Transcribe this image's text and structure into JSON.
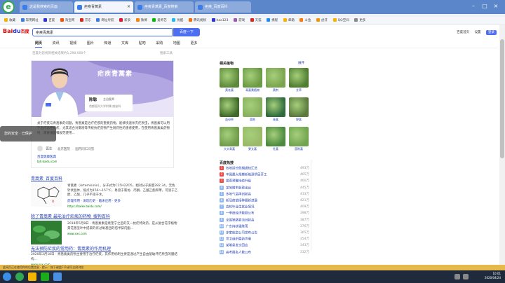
{
  "browser": {
    "tabs": [
      {
        "label": "这是我搜索的页面"
      },
      {
        "label": "疟疾青蒿素"
      },
      {
        "label": "疟疾青蒿素_百度搜索"
      },
      {
        "label": "疟疾_百度百科"
      }
    ],
    "bookmarks": [
      "收藏",
      "常用网址",
      "百度",
      "淘宝网",
      "京东",
      "网址导航",
      "新浪",
      "微博",
      "爱奇艺",
      "优酷",
      "腾讯视频",
      "hao123",
      "游戏",
      "天猫",
      "携程",
      "邮箱",
      "斗鱼",
      "虎牙",
      "QQ空间",
      "更多"
    ],
    "colors": {
      "accent": "#4e6ef2",
      "titlebar": "#5b86c9",
      "link": "#2440b3",
      "url": "#008000"
    }
  },
  "search": {
    "logo_text": "Bai",
    "logo_paw": "du",
    "logo_cn": "百度",
    "query": "疟疾青蒿素",
    "button_label": "百度一下",
    "top_links": [
      "百度首页",
      "设置",
      "登录"
    ]
  },
  "nav": {
    "tabs": [
      "网页",
      "资讯",
      "视频",
      "图片",
      "知道",
      "文库",
      "贴吧",
      "采购",
      "地图",
      "更多"
    ],
    "result_count": "百度为您找到相关结果约1,290,000个",
    "tools": "搜索工具"
  },
  "card": {
    "banner_title": "疟疾青蒿素",
    "doctor_name": "陈聪",
    "doctor_title": "主治医师",
    "doctor_dept": "首都医科大学附属 感染科",
    "text": "关于疟疾与青蒿素的问题，青蒿素是治疗疟疾的重要药物，能够快速杀灭疟原虫，青蒿素可以用于治疗恶性疟疾，尤其适合对氯喹等传统抗疟药物产生耐药性的患者使用，在使用青蒿素类药物时，需要遵医嘱规范使用...",
    "meta_author": "医生",
    "meta_tag": "北京医院",
    "meta_extra": "国内同仁问答",
    "source": "百度健康医典",
    "source_url": "bjh.baidu.com"
  },
  "tooltip": "您的安全 · 已保护",
  "results": [
    {
      "title": "青蒿素_百度百科",
      "body": "青蒿素（Artemisinin），分子式为C15H22O5，相对分子质量282.34，无色针状晶体，熔点为156～157℃，易溶于氯仿、丙酮、乙酸乙酯和苯，可溶于乙醇、乙醚，几乎不溶于水。",
      "links": "药理作用 · 发现历史 · 临床应用 · 更多",
      "url": "https://baike.baidu.com/"
    },
    {
      "title": "除了青蒿素 最能治疗疟疾的药物_搜狗百科",
      "body": "2018年5月8日 · 青蒿素素是继奎宁之后的又一抗疟特效药，是从复合花序植物黄花蒿茎叶中提取的有过氧基团的倍半萜内酯...",
      "url": "www.xxx.com"
    },
    {
      "title": "无法预防疟疾的常用药：青蒿素的作用机理",
      "body": "2020年3月18日 · 青蒿素类药物主要用于治疗疟疾，其作用机制主要是通过产生自由基破坏疟原虫的膜结构...",
      "url": "www.xxx.com"
    }
  ],
  "sidebar": {
    "title": "相关植物",
    "more": "展开",
    "plants": [
      {
        "label": "黄花蒿",
        "color": "#5c8a3a"
      },
      {
        "label": "青蒿素植物",
        "color": "#6b9a45"
      },
      {
        "label": "黄荆",
        "color": "#7ba44f"
      },
      {
        "label": "艾草",
        "color": "#4f7d32"
      },
      {
        "label": "益母草",
        "color": "#3f6b2a"
      },
      {
        "label": "茵陈",
        "color": "#86b05d"
      },
      {
        "label": "青蒿",
        "color": "#2f6b3c"
      },
      {
        "label": "野蒿",
        "color": "#5a7a3e"
      },
      {
        "label": "大头青蒿",
        "color": "#6f9c4b"
      },
      {
        "label": "野艾蒿",
        "color": "#9ab968"
      },
      {
        "label": "牡蒿",
        "color": "#4c8a3f"
      },
      {
        "label": "茵陈蒿",
        "color": "#72a450"
      }
    ],
    "hot_title": "百度热搜",
    "hot_items": [
      {
        "num": "1",
        "text": "各地延长假期通知汇总",
        "value": "493万"
      },
      {
        "num": "2",
        "text": "中国最大规模新能源项目开工",
        "value": "465万"
      },
      {
        "num": "3",
        "text": "暴雨预警持续升级",
        "value": "460万"
      },
      {
        "num": "4",
        "text": "某地楼市新政出台",
        "value": "445万"
      },
      {
        "num": "5",
        "text": "多地气温再创新高",
        "value": "433万"
      },
      {
        "num": "6",
        "text": "新冠疫苗接种最新进展",
        "value": "421万"
      },
      {
        "num": "7",
        "text": "高校毕业生就业情况",
        "value": "409万"
      },
      {
        "num": "8",
        "text": "一季度经济数据公布",
        "value": "398万"
      },
      {
        "num": "9",
        "text": "全国铁路客流创新高",
        "value": "387万"
      },
      {
        "num": "10",
        "text": "广东持续强降雨",
        "value": "376万"
      },
      {
        "num": "11",
        "text": "多家航空公司发布公告",
        "value": "365万"
      },
      {
        "num": "12",
        "text": "世卫组织最新声明",
        "value": "354万"
      },
      {
        "num": "13",
        "text": "某明星发文回应",
        "value": "343万"
      },
      {
        "num": "14",
        "text": "高考报名人数公布",
        "value": "332万"
      }
    ]
  },
  "statusbar": "此网页正在使用你的位置信息 · 提示：按下键盘F11键可全屏浏览",
  "clock": {
    "time": "10:01",
    "date": "2020/04/24"
  }
}
